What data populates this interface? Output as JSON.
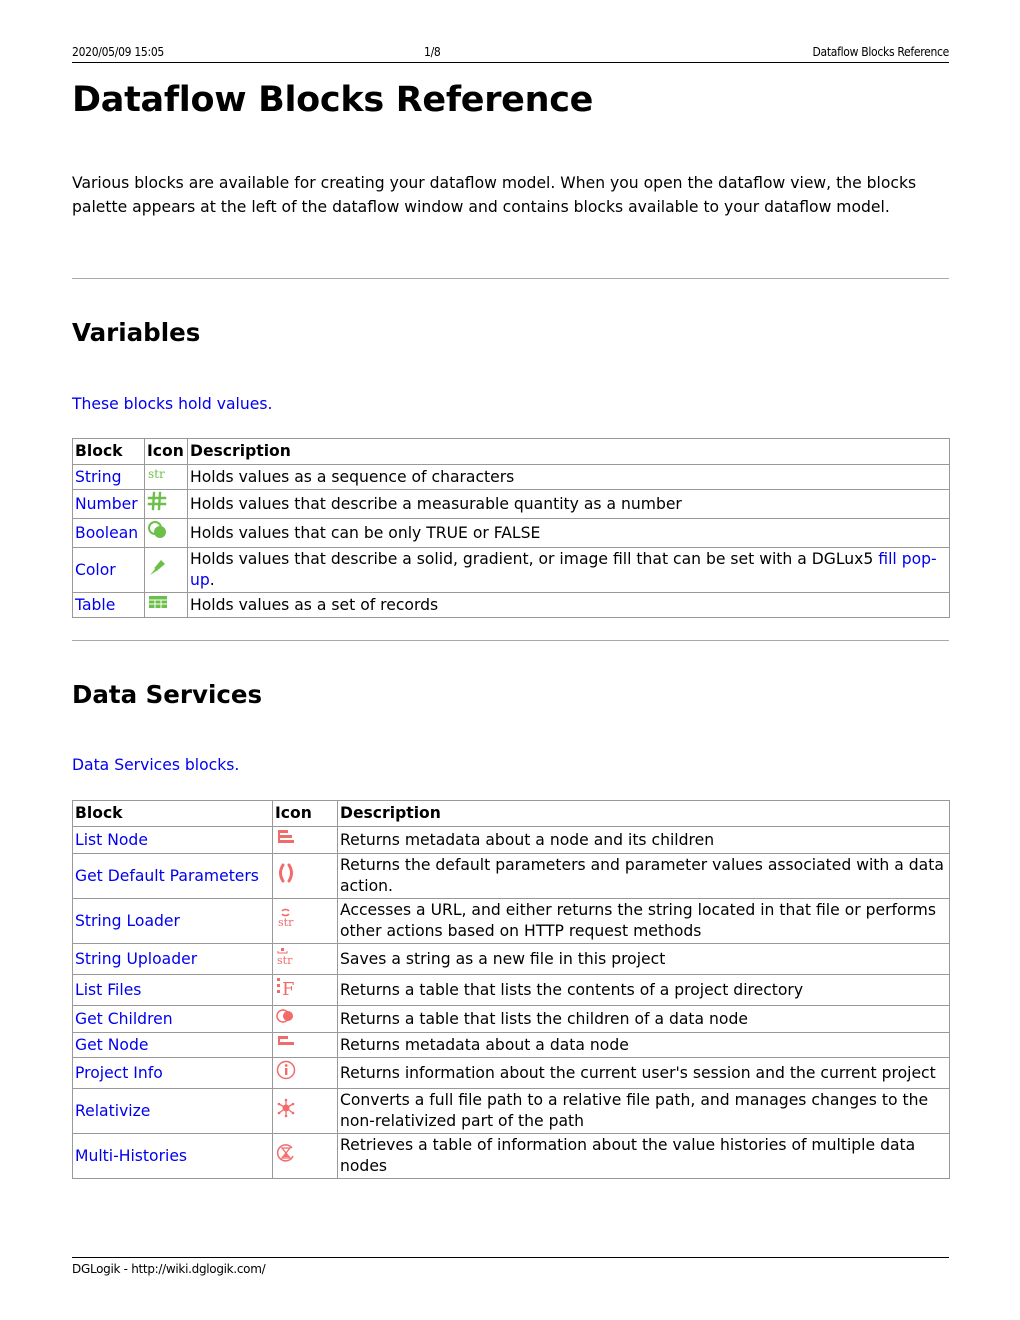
{
  "header": {
    "timestamp": "2020/05/09 15:05",
    "page_number": "1/8",
    "doc_title": "Dataflow Blocks Reference"
  },
  "title": "Dataflow Blocks Reference",
  "intro": "Various blocks are available for creating your dataflow model. When you open the dataflow view, the blocks palette appears at the left of the dataflow window and contains blocks available to your dataflow model.",
  "sections": {
    "variables": {
      "heading": "Variables",
      "lead": "These blocks hold values.",
      "columns": [
        "Block",
        "Icon",
        "Description"
      ],
      "rows": [
        {
          "block": "String",
          "icon": "str-icon",
          "description": "Holds values as a sequence of characters"
        },
        {
          "block": "Number",
          "icon": "hash-icon",
          "description": "Holds values that describe a measurable quantity as a number"
        },
        {
          "block": "Boolean",
          "icon": "boolean-icon",
          "description": "Holds values that can be only TRUE or FALSE"
        },
        {
          "block": "Color",
          "icon": "paintbrush-icon",
          "description": "Holds values that describe a solid, gradient, or image fill that can be set with a DGLux5 ",
          "link": "fill pop-up",
          "suffix": "."
        },
        {
          "block": "Table",
          "icon": "table-icon",
          "description": "Holds values as a set of records"
        }
      ]
    },
    "data_services": {
      "heading": "Data Services",
      "lead": "Data Services blocks.",
      "columns": [
        "Block",
        "Icon",
        "Description"
      ],
      "rows": [
        {
          "block": "List Node",
          "icon": "list-node-icon",
          "description": "Returns metadata about a node and its children"
        },
        {
          "block": "Get Default Parameters",
          "icon": "parentheses-icon",
          "description": "Returns the default parameters and parameter values associated with a data action."
        },
        {
          "block": "String Loader",
          "icon": "string-loader-icon",
          "description": "Accesses a URL, and either returns the string located in that file or performs other actions based on HTTP request methods"
        },
        {
          "block": "String Uploader",
          "icon": "string-uploader-icon",
          "description": "Saves a string as a new file in this project"
        },
        {
          "block": "List Files",
          "icon": "list-files-icon",
          "description": "Returns a table that lists the contents of a project directory"
        },
        {
          "block": "Get Children",
          "icon": "get-children-icon",
          "description": "Returns a table that lists the children of a data node"
        },
        {
          "block": "Get Node",
          "icon": "get-node-icon",
          "description": "Returns metadata about a data node"
        },
        {
          "block": "Project Info",
          "icon": "info-icon",
          "description": "Returns information about the current user's session and the current project"
        },
        {
          "block": "Relativize",
          "icon": "relativize-icon",
          "description": "Converts a full file path to a relative file path, and manages changes to the non-relativized part of the path"
        },
        {
          "block": "Multi-Histories",
          "icon": "history-icon",
          "description": "Retrieves a table of information about the value histories of multiple data nodes"
        }
      ]
    }
  },
  "footer": {
    "text": "DGLogik - http://wiki.dglogik.com/"
  },
  "colors": {
    "link": "#0000ee",
    "variable_icon": "#6cc04a",
    "service_icon": "#f26b6b"
  }
}
